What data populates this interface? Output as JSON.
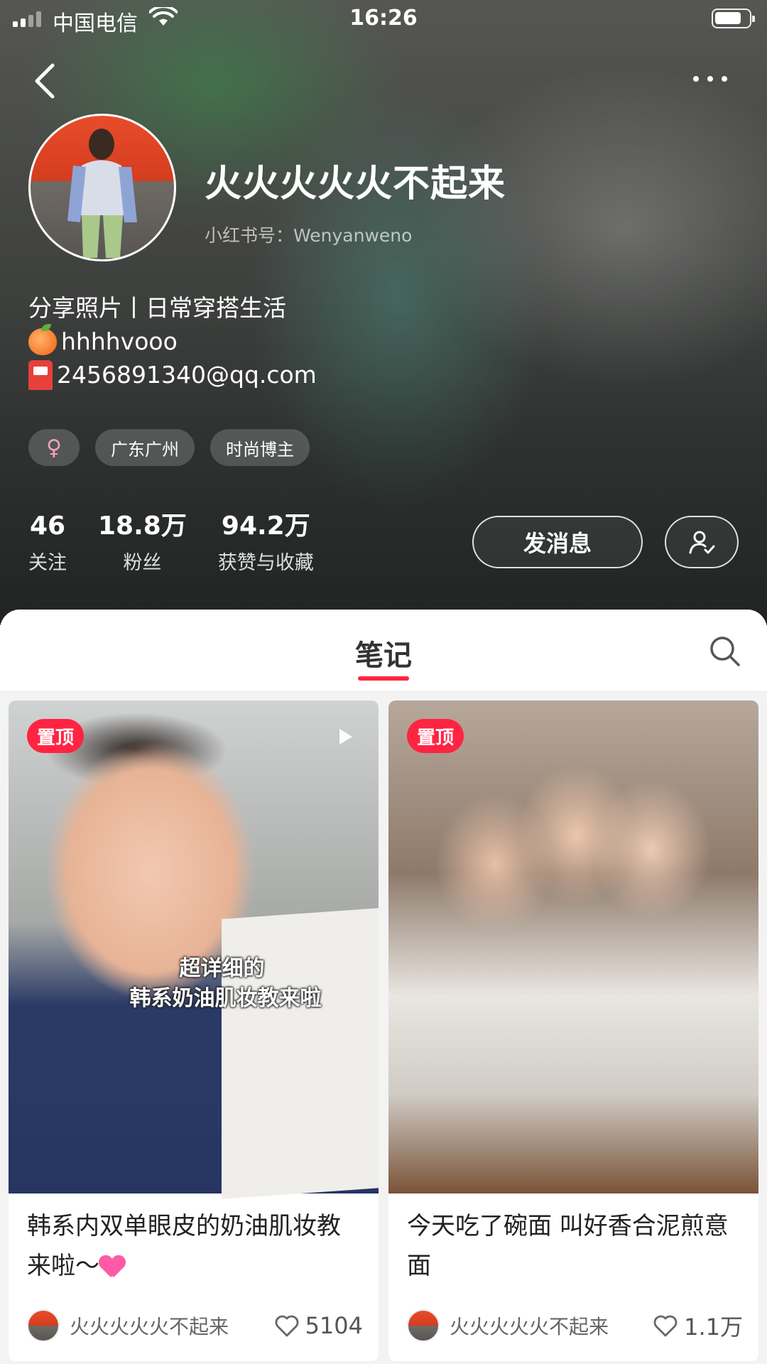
{
  "status_bar": {
    "carrier": "中国电信",
    "time": "16:26"
  },
  "profile": {
    "nickname": "火火火火火不起来",
    "red_id": "小红书号：Wenyanweno",
    "bio": [
      "分享照片丨日常穿搭生活",
      "hhhhvooo",
      "2456891340@qq.com"
    ],
    "tags": [
      {
        "icon": "female-icon",
        "label": "♀"
      },
      {
        "label": "广东广州"
      },
      {
        "label": "时尚博主"
      }
    ],
    "stats": [
      {
        "value": "46",
        "label": "关注"
      },
      {
        "value": "18.8万",
        "label": "粉丝"
      },
      {
        "value": "94.2万",
        "label": "获赞与收藏"
      }
    ],
    "message_button": "发消息"
  },
  "tabs": {
    "notes": "笔记"
  },
  "notes": [
    {
      "badge": "置顶",
      "overlay_line1": "超详细的",
      "overlay_line2": "韩系奶油肌妆教来啦",
      "title": "韩系内双单眼皮的奶油肌妆教来啦～",
      "author": "火火火火火不起来",
      "likes": "5104"
    },
    {
      "badge": "置顶",
      "title": "今天吃了碗面 叫好香合泥煎意面",
      "author": "火火火火火不起来",
      "likes": "1.1万"
    }
  ],
  "colors": {
    "accent": "#ff2442",
    "sheet_bg": "#f3f3f3"
  }
}
